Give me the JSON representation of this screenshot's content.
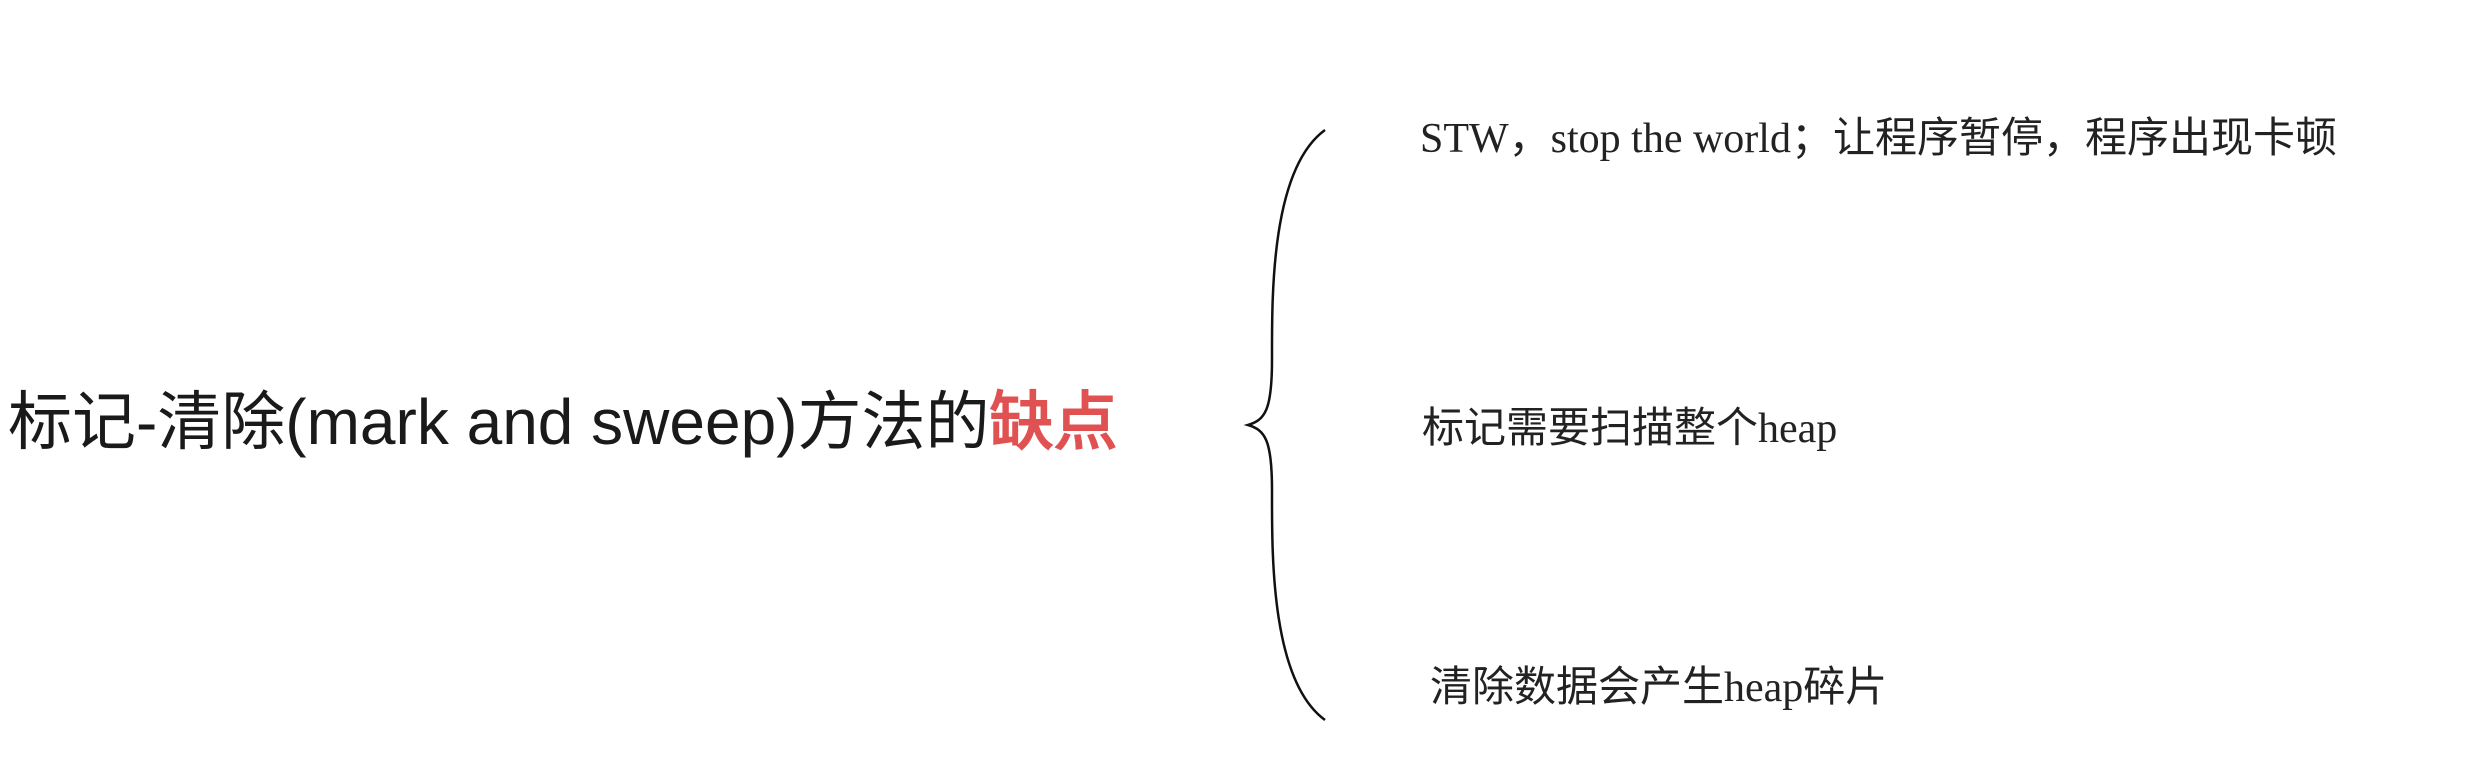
{
  "title": {
    "prefix": "标记-清除(mark and sweep)方法的",
    "highlight": "缺点",
    "highlight_color": "#e05252"
  },
  "points": [
    "STW，stop the world；让程序暂停，程序出现卡顿",
    "标记需要扫描整个heap",
    "清除数据会产生heap碎片"
  ]
}
